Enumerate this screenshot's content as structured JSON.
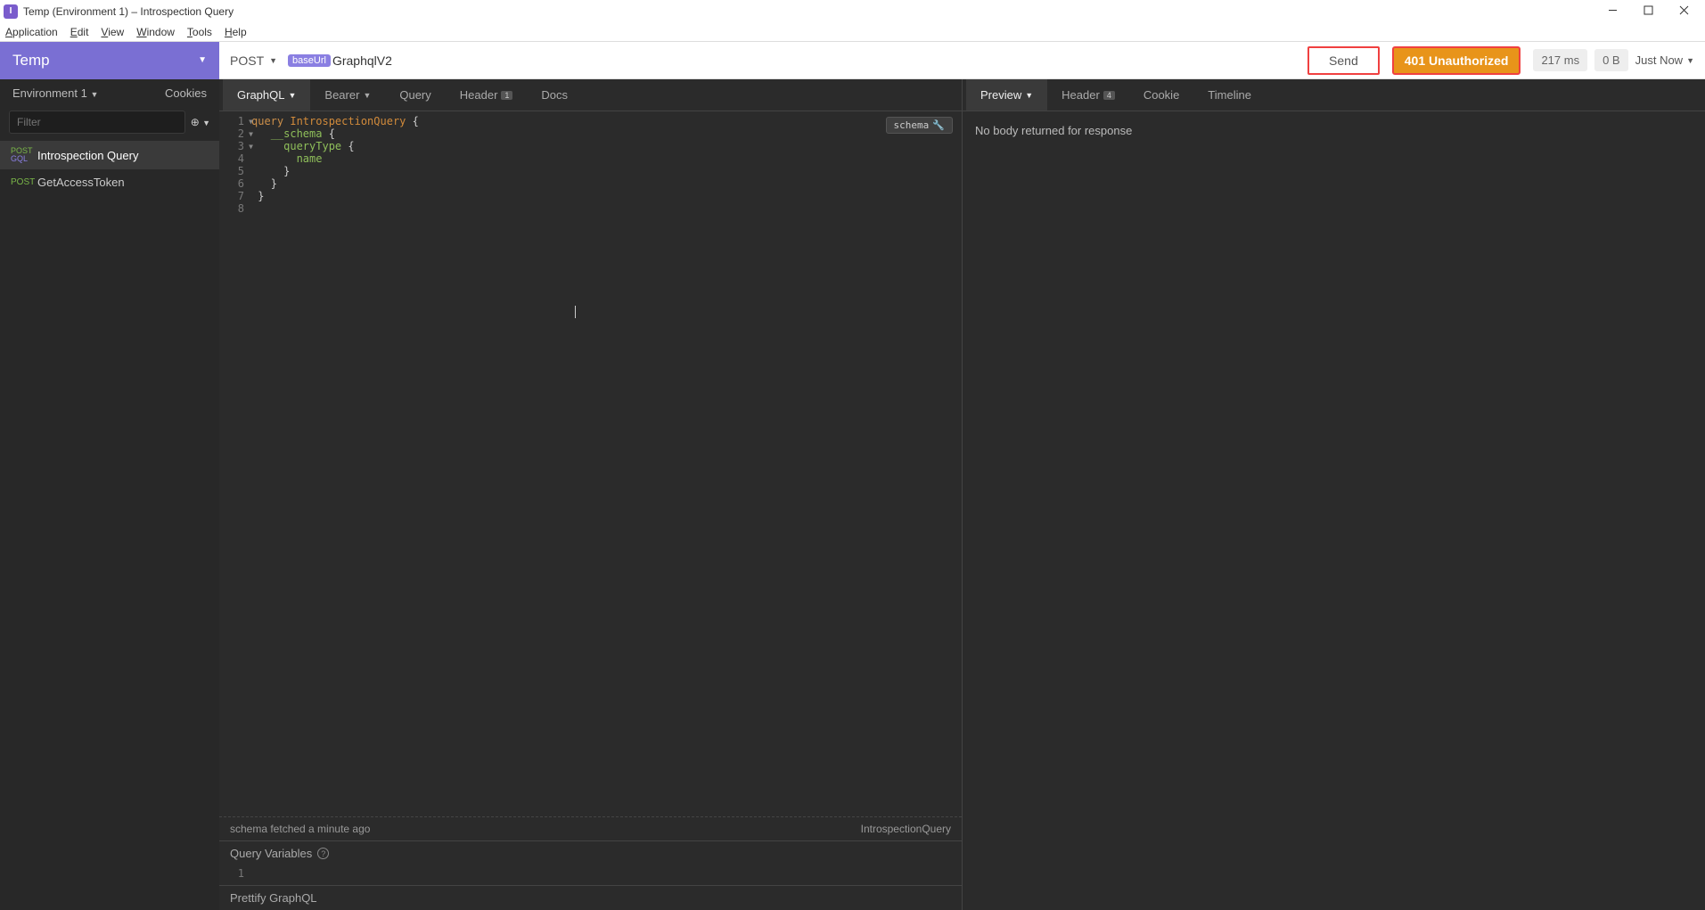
{
  "window": {
    "title": "Temp (Environment 1) – Introspection Query"
  },
  "menu": {
    "items": [
      "Application",
      "Edit",
      "View",
      "Window",
      "Tools",
      "Help"
    ]
  },
  "workspace": {
    "name": "Temp"
  },
  "request": {
    "method": "POST",
    "baseUrlTag": "baseUrl",
    "endpoint": "GraphqlV2",
    "sendLabel": "Send",
    "status": "401 Unauthorized",
    "time": "217 ms",
    "size": "0 B",
    "history": "Just Now"
  },
  "sidebar": {
    "envLabel": "Environment 1",
    "cookiesLabel": "Cookies",
    "filterPlaceholder": "Filter",
    "items": [
      {
        "method1": "POST",
        "method2": "GQL",
        "name": "Introspection Query",
        "active": true
      },
      {
        "method1": "POST",
        "method2": "",
        "name": "GetAccessToken",
        "active": false
      }
    ]
  },
  "reqTabs": {
    "graphql": "GraphQL",
    "bearer": "Bearer",
    "query": "Query",
    "header": "Header",
    "headerBadge": "1",
    "docs": "Docs"
  },
  "editor": {
    "schemaBtn": "schema",
    "lines": [
      {
        "n": "1",
        "fold": true,
        "html": "<span class='kw-query'>query</span> <span class='kw-name'>IntrospectionQuery</span> <span class='brace'>{</span>"
      },
      {
        "n": "2",
        "fold": true,
        "html": "   <span class='kw-field'>__schema</span> <span class='brace'>{</span>"
      },
      {
        "n": "3",
        "fold": true,
        "html": "     <span class='kw-field'>queryType</span> <span class='brace'>{</span>"
      },
      {
        "n": "4",
        "fold": false,
        "html": "       <span class='kw-field'>name</span>"
      },
      {
        "n": "5",
        "fold": false,
        "html": "     <span class='brace'>}</span>"
      },
      {
        "n": "6",
        "fold": false,
        "html": "   <span class='brace'>}</span>"
      },
      {
        "n": "7",
        "fold": false,
        "html": " <span class='brace'>}</span>"
      },
      {
        "n": "8",
        "fold": false,
        "html": ""
      }
    ],
    "statusLeft": "schema fetched a minute ago",
    "statusRight": "IntrospectionQuery",
    "queryVarsLabel": "Query Variables",
    "prettifyLabel": "Prettify GraphQL"
  },
  "respTabs": {
    "preview": "Preview",
    "header": "Header",
    "headerBadge": "4",
    "cookie": "Cookie",
    "timeline": "Timeline"
  },
  "response": {
    "body": "No body returned for response"
  }
}
